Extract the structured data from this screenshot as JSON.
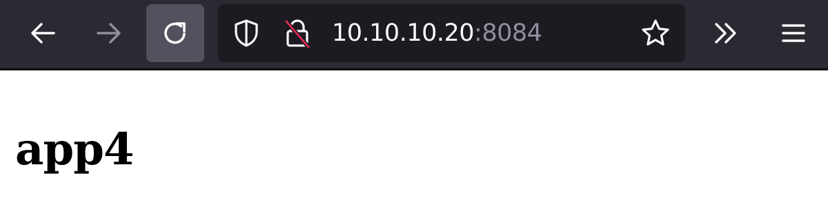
{
  "toolbar": {
    "icons": {
      "back": "arrow-left-icon",
      "forward": "arrow-right-icon",
      "reload": "reload-icon",
      "overflow": "chevron-double-right-icon",
      "menu": "hamburger-menu-icon"
    },
    "forward_disabled": true,
    "colors": {
      "toolbar_bg": "#2b2a33",
      "urlbar_bg": "#1c1b22",
      "reload_hover_bg": "#52525e",
      "icon": "#fbfbfe",
      "icon_disabled": "#8f8f9d",
      "insecure_slash": "#e22850"
    }
  },
  "urlbar": {
    "host": "10.10.10.20",
    "port": ":8084",
    "icons": {
      "tracking": "shield-icon",
      "connection": "insecure-lock-icon",
      "bookmark": "star-icon"
    }
  },
  "page": {
    "heading": "app4"
  }
}
